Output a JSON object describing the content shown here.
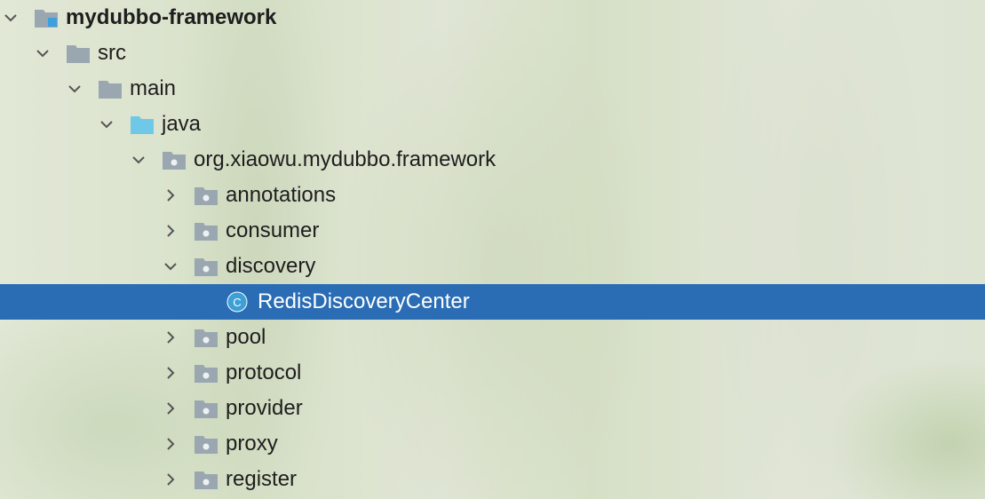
{
  "project_tree": {
    "nodes": [
      {
        "label": "mydubbo-framework",
        "icon": "module-folder-icon",
        "expanded": true
      },
      {
        "label": "src",
        "icon": "folder-icon",
        "expanded": true
      },
      {
        "label": "main",
        "icon": "folder-icon",
        "expanded": true
      },
      {
        "label": "java",
        "icon": "source-root-folder-icon",
        "expanded": true
      },
      {
        "label": "org.xiaowu.mydubbo.framework",
        "icon": "package-icon",
        "expanded": true
      },
      {
        "label": "annotations",
        "icon": "package-icon",
        "expanded": false
      },
      {
        "label": "consumer",
        "icon": "package-icon",
        "expanded": false
      },
      {
        "label": "discovery",
        "icon": "package-icon",
        "expanded": true
      },
      {
        "label": "RedisDiscoveryCenter",
        "icon": "java-class-icon",
        "selected": true,
        "class_badge": "C"
      },
      {
        "label": "pool",
        "icon": "package-icon",
        "expanded": false
      },
      {
        "label": "protocol",
        "icon": "package-icon",
        "expanded": false
      },
      {
        "label": "provider",
        "icon": "package-icon",
        "expanded": false
      },
      {
        "label": "proxy",
        "icon": "package-icon",
        "expanded": false
      },
      {
        "label": "register",
        "icon": "package-icon",
        "expanded": false
      }
    ]
  },
  "colors": {
    "selection": "#2a6db4",
    "folder": "#9aa7b0",
    "source_root": "#70c8e8",
    "class_icon": "#3d9fd6",
    "text": "#1e1e1e"
  }
}
